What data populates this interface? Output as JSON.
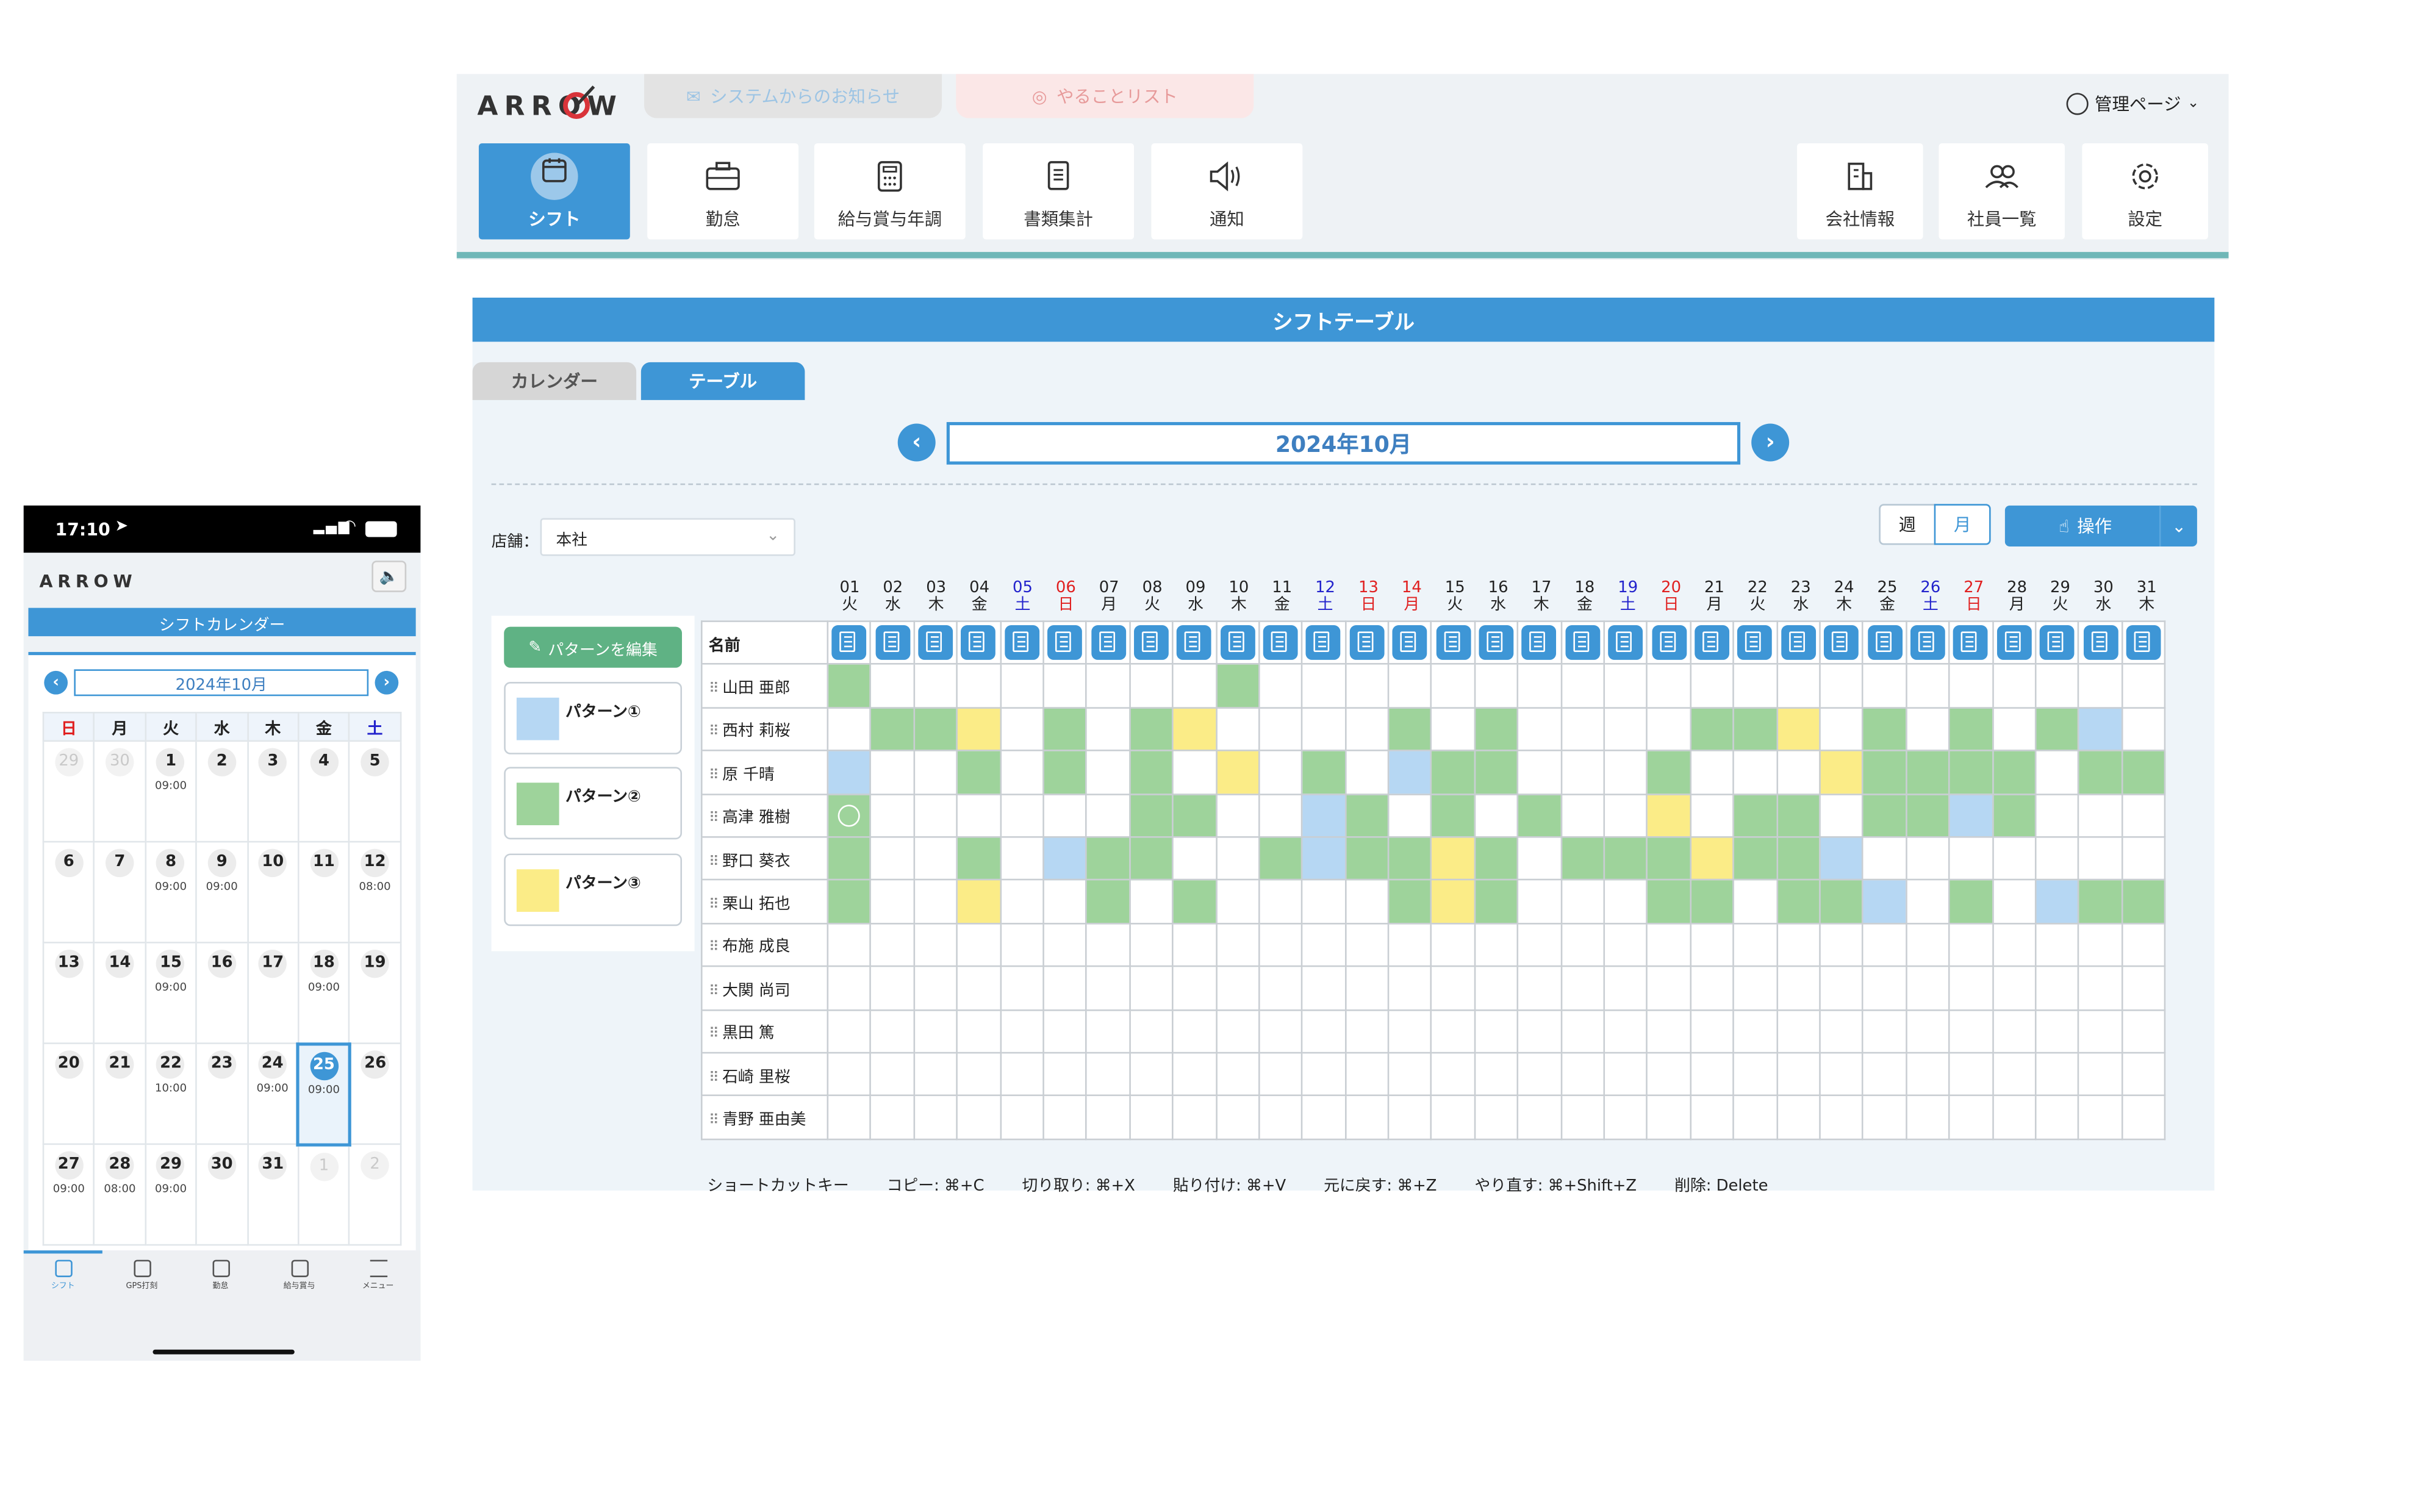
{
  "desktop": {
    "logo": "ARROW",
    "top_tabs": {
      "notice": "システムからのお知らせ",
      "todo": "やることリスト"
    },
    "admin_menu": "管理ページ",
    "nav": [
      {
        "label": "シフト",
        "active": true,
        "icon": "calendar-icon"
      },
      {
        "label": "勤怠",
        "icon": "briefcase-icon"
      },
      {
        "label": "給与賞与年調",
        "icon": "calculator-icon"
      },
      {
        "label": "書類集計",
        "icon": "document-icon"
      },
      {
        "label": "通知",
        "icon": "speaker-icon"
      }
    ],
    "nav_right": [
      {
        "label": "会社情報",
        "icon": "building-icon"
      },
      {
        "label": "社員一覧",
        "icon": "people-icon"
      },
      {
        "label": "設定",
        "icon": "gear-icon"
      }
    ],
    "panel_title": "シフトテーブル",
    "view_tabs": {
      "calendar": "カレンダー",
      "table": "テーブル"
    },
    "month": "2024年10月",
    "store_label": "店舗：",
    "store_value": "本社",
    "week_label": "週",
    "month_label": "月",
    "operation_label": "操作",
    "edit_pattern": "パターンを編集",
    "patterns": [
      {
        "label": "パターン①",
        "color": "#b6d7f3"
      },
      {
        "label": "パターン②",
        "color": "#9ed39b"
      },
      {
        "label": "パターン③",
        "color": "#fbec87"
      }
    ],
    "name_header": "名前",
    "days": [
      {
        "d": "01",
        "w": "火",
        "t": "n"
      },
      {
        "d": "02",
        "w": "水",
        "t": "n"
      },
      {
        "d": "03",
        "w": "木",
        "t": "n"
      },
      {
        "d": "04",
        "w": "金",
        "t": "n"
      },
      {
        "d": "05",
        "w": "土",
        "t": "sat"
      },
      {
        "d": "06",
        "w": "日",
        "t": "sun"
      },
      {
        "d": "07",
        "w": "月",
        "t": "n"
      },
      {
        "d": "08",
        "w": "火",
        "t": "n"
      },
      {
        "d": "09",
        "w": "水",
        "t": "n"
      },
      {
        "d": "10",
        "w": "木",
        "t": "n"
      },
      {
        "d": "11",
        "w": "金",
        "t": "n"
      },
      {
        "d": "12",
        "w": "土",
        "t": "sat"
      },
      {
        "d": "13",
        "w": "日",
        "t": "sun"
      },
      {
        "d": "14",
        "w": "月",
        "t": "sun"
      },
      {
        "d": "15",
        "w": "火",
        "t": "n"
      },
      {
        "d": "16",
        "w": "水",
        "t": "n"
      },
      {
        "d": "17",
        "w": "木",
        "t": "n"
      },
      {
        "d": "18",
        "w": "金",
        "t": "n"
      },
      {
        "d": "19",
        "w": "土",
        "t": "sat"
      },
      {
        "d": "20",
        "w": "日",
        "t": "sun"
      },
      {
        "d": "21",
        "w": "月",
        "t": "n"
      },
      {
        "d": "22",
        "w": "火",
        "t": "n"
      },
      {
        "d": "23",
        "w": "水",
        "t": "n"
      },
      {
        "d": "24",
        "w": "木",
        "t": "n"
      },
      {
        "d": "25",
        "w": "金",
        "t": "n"
      },
      {
        "d": "26",
        "w": "土",
        "t": "sat"
      },
      {
        "d": "27",
        "w": "日",
        "t": "sun"
      },
      {
        "d": "28",
        "w": "月",
        "t": "n"
      },
      {
        "d": "29",
        "w": "火",
        "t": "n"
      },
      {
        "d": "30",
        "w": "水",
        "t": "n"
      },
      {
        "d": "31",
        "w": "木",
        "t": "n"
      }
    ],
    "employees": [
      {
        "name": "山田 亜郎",
        "shifts": "2000000002000000000000000000000"
      },
      {
        "name": "西村 莉桜",
        "shifts": "0223020230000202000022302020210"
      },
      {
        "name": "原 千晴",
        "shifts": "1002020203020122000200032222022"
      },
      {
        "name": "高津 雅樹",
        "shifts": "2000000220012020200302202212000"
      },
      {
        "name": "野口 葵衣",
        "shifts": "2002012200212232022232210000000"
      },
      {
        "name": "栗山 拓也",
        "shifts": "2003002020000232000220221020122"
      },
      {
        "name": "布施 成良",
        "shifts": "0000000000000000000000000000000"
      },
      {
        "name": "大関 尚司",
        "shifts": "0000000000000000000000000000000"
      },
      {
        "name": "黒田 篤",
        "shifts": "0000000000000000000000000000000"
      },
      {
        "name": "石崎 里桜",
        "shifts": "0000000000000000000000000000000"
      },
      {
        "name": "青野 亜由美",
        "shifts": "0000000000000000000000000000000"
      }
    ],
    "shortcuts": [
      "ショートカットキー",
      "コピー: ⌘+C",
      "切り取り: ⌘+X",
      "貼り付け: ⌘+V",
      "元に戻す: ⌘+Z",
      "やり直す: ⌘+Shift+Z",
      "削除: Delete"
    ]
  },
  "phone": {
    "time": "17:10",
    "logo": "ARROW",
    "title": "シフトカレンダー",
    "month": "2024年10月",
    "weekdays": [
      "日",
      "月",
      "火",
      "水",
      "木",
      "金",
      "土"
    ],
    "weeks": [
      [
        {
          "d": "29",
          "o": true
        },
        {
          "d": "30",
          "o": true
        },
        {
          "d": "1",
          "t": "09:00"
        },
        {
          "d": "2"
        },
        {
          "d": "3"
        },
        {
          "d": "4"
        },
        {
          "d": "5"
        }
      ],
      [
        {
          "d": "6"
        },
        {
          "d": "7"
        },
        {
          "d": "8",
          "t": "09:00"
        },
        {
          "d": "9",
          "t": "09:00"
        },
        {
          "d": "10"
        },
        {
          "d": "11"
        },
        {
          "d": "12",
          "t": "08:00"
        }
      ],
      [
        {
          "d": "13"
        },
        {
          "d": "14"
        },
        {
          "d": "15",
          "t": "09:00"
        },
        {
          "d": "16"
        },
        {
          "d": "17"
        },
        {
          "d": "18",
          "t": "09:00"
        },
        {
          "d": "19"
        }
      ],
      [
        {
          "d": "20"
        },
        {
          "d": "21"
        },
        {
          "d": "22",
          "t": "10:00"
        },
        {
          "d": "23"
        },
        {
          "d": "24",
          "t": "09:00"
        },
        {
          "d": "25",
          "t": "09:00",
          "sel": true
        },
        {
          "d": "26"
        }
      ],
      [
        {
          "d": "27",
          "t": "09:00"
        },
        {
          "d": "28",
          "t": "08:00"
        },
        {
          "d": "29",
          "t": "09:00"
        },
        {
          "d": "30"
        },
        {
          "d": "31"
        },
        {
          "d": "1",
          "o": true
        },
        {
          "d": "2",
          "o": true
        }
      ]
    ],
    "tabs": [
      "シフト",
      "GPS打刻",
      "勤怠",
      "給与賞与",
      "メニュー"
    ]
  },
  "colors": {
    "accent": "#3e96d6",
    "pattern1": "#b6d7f3",
    "pattern2": "#9ed39b",
    "pattern3": "#fbec87",
    "sat": "#2222cc",
    "sun": "#e02020"
  }
}
